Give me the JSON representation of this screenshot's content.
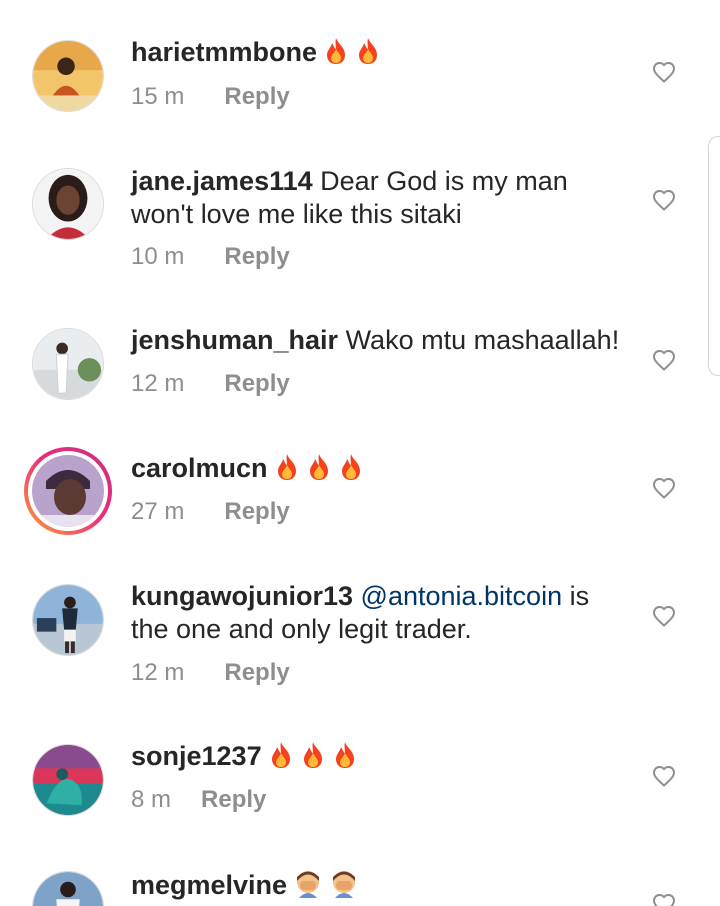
{
  "comments": [
    {
      "username": "harietmmbone",
      "text": "",
      "emojis": [
        "fire",
        "fire"
      ],
      "time": "15 m",
      "reply": "Reply",
      "avatar_colors": [
        "#f3c56a",
        "#c8541f"
      ]
    },
    {
      "username": "jane.james114",
      "text": "Dear God is my man won't love me like this sitaki",
      "emojis": [],
      "time": "10 m",
      "reply": "Reply",
      "avatar_colors": [
        "#3a2a24",
        "#c22e3c"
      ]
    },
    {
      "username": "jenshuman_hair",
      "text": "Wako mtu mashaallah!",
      "emojis": [],
      "time": "12 m",
      "reply": "Reply",
      "avatar_colors": [
        "#e9edf0",
        "#6b8f5a"
      ]
    },
    {
      "username": "carolmucn",
      "text": "",
      "emojis": [
        "fire",
        "fire",
        "fire"
      ],
      "time": "27 m",
      "reply": "Reply",
      "avatar_colors": [
        "#b9a3cc",
        "#3d2a3e"
      ]
    },
    {
      "username": "kungawojunior13",
      "mention": "@antonia.bitcoin",
      "text": "is the one and only legit trader.",
      "emojis": [],
      "time": "12 m",
      "reply": "Reply",
      "avatar_colors": [
        "#8fb3d9",
        "#2b3f5a"
      ]
    },
    {
      "username": "sonje1237",
      "text": "",
      "emojis": [
        "fire",
        "fire",
        "fire"
      ],
      "time": "8 m",
      "reply": "Reply",
      "avatar_colors": [
        "#d9365a",
        "#1c8a8f"
      ]
    },
    {
      "username": "megmelvine",
      "text": "",
      "emojis": [
        "face-palm",
        "face-palm"
      ],
      "time": "",
      "reply": "",
      "avatar_colors": [
        "#7fa2c9",
        "#f5f5f5"
      ]
    }
  ],
  "icons": {
    "like": "heart-outline-icon",
    "fire": "fire-emoji",
    "face-palm": "face-palm-emoji"
  },
  "colors": {
    "text": "#262626",
    "secondary": "#8e8e8e",
    "mention": "#003569",
    "story_ring": "#ee2a7b"
  }
}
